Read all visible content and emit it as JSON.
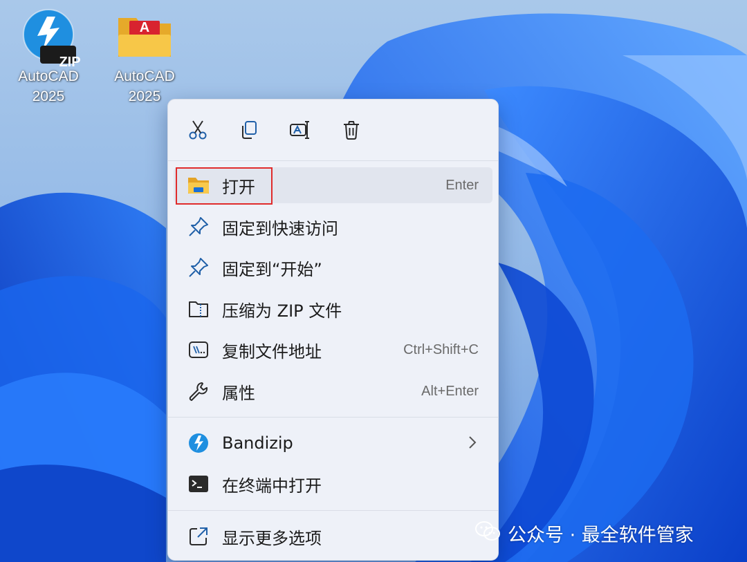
{
  "desktop": {
    "icons": [
      {
        "label": "AutoCAD\n2025",
        "icon": "bandizip-zip-icon",
        "badge": "ZIP"
      },
      {
        "label": "AutoCAD\n2025",
        "icon": "folder-autocad-icon",
        "badge": "A"
      }
    ]
  },
  "context_menu": {
    "toolbar": [
      {
        "name": "cut",
        "icon": "scissors-icon"
      },
      {
        "name": "copy",
        "icon": "copy-icon"
      },
      {
        "name": "rename",
        "icon": "rename-icon"
      },
      {
        "name": "delete",
        "icon": "trash-icon"
      }
    ],
    "items": [
      {
        "label": "打开",
        "shortcut": "Enter",
        "icon": "folder-open-icon"
      },
      {
        "label": "固定到快速访问",
        "shortcut": "",
        "icon": "pin-icon"
      },
      {
        "label": "固定到“开始”",
        "shortcut": "",
        "icon": "pin-icon"
      },
      {
        "label": "压缩为 ZIP 文件",
        "shortcut": "",
        "icon": "zip-folder-icon"
      },
      {
        "label": "复制文件地址",
        "shortcut": "Ctrl+Shift+C",
        "icon": "path-copy-icon"
      },
      {
        "label": "属性",
        "shortcut": "Alt+Enter",
        "icon": "wrench-icon"
      },
      {
        "label": "Bandizip",
        "shortcut": "",
        "icon": "bandizip-icon",
        "submenu": true
      },
      {
        "label": "在终端中打开",
        "shortcut": "",
        "icon": "terminal-icon"
      },
      {
        "label": "显示更多选项",
        "shortcut": "",
        "icon": "more-options-icon"
      }
    ]
  },
  "watermark": {
    "text": "公众号 · 最全软件管家",
    "icon": "wechat-icon"
  },
  "colors": {
    "accent": "#0067c0",
    "highlight_box": "#e02b2b",
    "menu_bg": "#eef1f8",
    "folder_yellow": "#f7c748"
  }
}
